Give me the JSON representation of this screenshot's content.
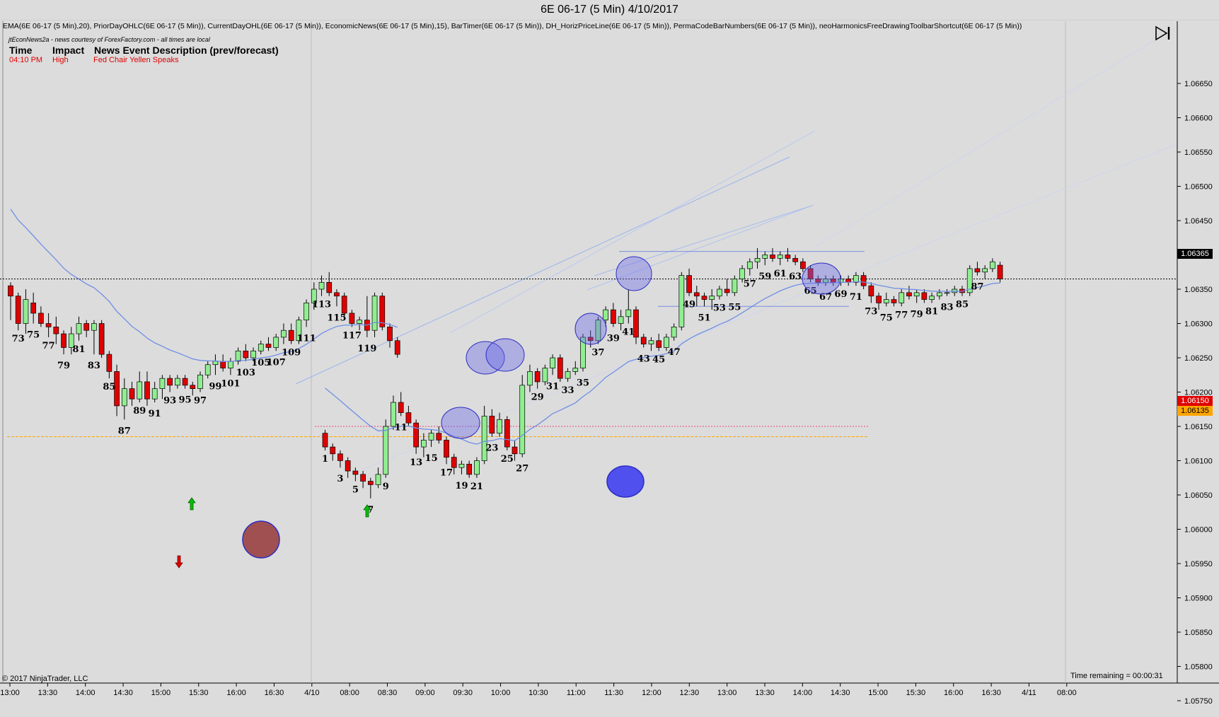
{
  "window": {
    "title": "6E 06-17 (5 Min)  4/10/2017"
  },
  "indicators_line": "EMA(6E 06-17 (5 Min),20), PriorDayOHLC(6E 06-17 (5 Min)), CurrentDayOHL(6E 06-17 (5 Min)), EconomicNews(6E 06-17 (5 Min),15), BarTimer(6E 06-17 (5 Min)), DH_HorizPriceLine(6E 06-17 (5 Min)), PermaCodeBarNumbers(6E 06-17 (5 Min)), neoHarmonicsFreeDrawingToolbarShortcut(6E 06-17 (5 Min))",
  "news": {
    "credit": "jtEconNews2a - news courtesy of ForexFactory.com - all times are local",
    "headers": {
      "time": "Time",
      "impact": "Impact",
      "desc": "News Event Description (prev/forecast)"
    },
    "event": {
      "time": "04:10 PM",
      "impact": "High",
      "desc": "Fed Chair Yellen Speaks"
    }
  },
  "footer": {
    "copyright": "© 2017 NinjaTrader, LLC",
    "time_remaining": "Time remaining = 00:00:31"
  },
  "colors": {
    "up": "#90ee90",
    "down": "#e00000",
    "ema": "#6f8fe6",
    "circle": "#6a6ae8",
    "orange": "#ffa500",
    "pink": "#e84a7a",
    "background": "#dcdcdc"
  },
  "icons": {
    "play": "skip-forward-icon",
    "up_arrow": "green-up-arrow-icon",
    "down_arrow": "red-down-arrow-icon"
  },
  "chart_data": {
    "type": "candlestick",
    "title": "6E 06-17 (5 Min)  4/10/2017",
    "ylim": [
      1.0573,
      1.067
    ],
    "yticks": [
      "1.06650",
      "1.06600",
      "1.06550",
      "1.06500",
      "1.06450",
      "1.06400",
      "1.06350",
      "1.06300",
      "1.06250",
      "1.06200",
      "1.06150",
      "1.06100",
      "1.06050",
      "1.06000",
      "1.05950",
      "1.05900",
      "1.05850",
      "1.05800",
      "1.05750"
    ],
    "xticks": [
      "13:00",
      "13:30",
      "14:00",
      "14:30",
      "15:00",
      "15:30",
      "16:00",
      "16:30",
      "4/10",
      "08:00",
      "08:30",
      "09:00",
      "09:30",
      "10:00",
      "10:30",
      "11:00",
      "11:30",
      "12:00",
      "12:30",
      "13:00",
      "13:30",
      "14:00",
      "14:30",
      "15:00",
      "15:30",
      "16:00",
      "16:30",
      "4/11",
      "08:00"
    ],
    "grid": false,
    "sessions": [
      {
        "start_bar": 72,
        "candles": [
          [
            1.06355,
            1.0636,
            1.06305,
            1.0634
          ],
          [
            1.0634,
            1.06345,
            1.0629,
            1.063
          ],
          [
            1.063,
            1.0635,
            1.06285,
            1.06335
          ],
          [
            1.0633,
            1.06345,
            1.063,
            1.06315
          ],
          [
            1.06315,
            1.06325,
            1.06295,
            1.063
          ],
          [
            1.063,
            1.06315,
            1.0628,
            1.06295
          ],
          [
            1.06295,
            1.0631,
            1.0627,
            1.06285
          ],
          [
            1.06285,
            1.0629,
            1.06255,
            1.06265
          ],
          [
            1.06265,
            1.06295,
            1.06255,
            1.06285
          ],
          [
            1.06285,
            1.0631,
            1.06275,
            1.063
          ],
          [
            1.063,
            1.06305,
            1.0628,
            1.0629
          ],
          [
            1.0629,
            1.06305,
            1.06255,
            1.063
          ],
          [
            1.063,
            1.06305,
            1.0625,
            1.06255
          ],
          [
            1.06255,
            1.0626,
            1.0622,
            1.0623
          ],
          [
            1.0623,
            1.0624,
            1.06165,
            1.0618
          ],
          [
            1.0618,
            1.0622,
            1.0616,
            1.06205
          ],
          [
            1.06205,
            1.06215,
            1.0618,
            1.0619
          ],
          [
            1.0619,
            1.0623,
            1.06185,
            1.06215
          ],
          [
            1.06215,
            1.0623,
            1.0618,
            1.0619
          ],
          [
            1.0619,
            1.06215,
            1.06185,
            1.06205
          ],
          [
            1.06205,
            1.06225,
            1.0619,
            1.0622
          ],
          [
            1.0622,
            1.06225,
            1.062,
            1.0621
          ],
          [
            1.0621,
            1.06225,
            1.06205,
            1.0622
          ],
          [
            1.0622,
            1.06225,
            1.06205,
            1.0621
          ],
          [
            1.0621,
            1.06215,
            1.06195,
            1.06205
          ],
          [
            1.06205,
            1.0623,
            1.062,
            1.06225
          ],
          [
            1.06225,
            1.06245,
            1.0622,
            1.0624
          ],
          [
            1.0624,
            1.06255,
            1.06225,
            1.06245
          ],
          [
            1.06245,
            1.06255,
            1.0623,
            1.06235
          ],
          [
            1.06235,
            1.0625,
            1.06225,
            1.06245
          ],
          [
            1.06245,
            1.06265,
            1.0624,
            1.0626
          ],
          [
            1.0626,
            1.0627,
            1.06245,
            1.0625
          ],
          [
            1.0625,
            1.06265,
            1.06245,
            1.0626
          ],
          [
            1.0626,
            1.06275,
            1.06255,
            1.0627
          ],
          [
            1.0627,
            1.0628,
            1.0626,
            1.06265
          ],
          [
            1.06265,
            1.06285,
            1.0626,
            1.0628
          ],
          [
            1.0628,
            1.063,
            1.0627,
            1.0629
          ],
          [
            1.0629,
            1.063,
            1.0627,
            1.06275
          ],
          [
            1.06275,
            1.0631,
            1.0627,
            1.06305
          ],
          [
            1.06305,
            1.06335,
            1.06295,
            1.0633
          ],
          [
            1.0633,
            1.0636,
            1.0632,
            1.0635
          ],
          [
            1.0635,
            1.0637,
            1.0634,
            1.0636
          ],
          [
            1.0636,
            1.06375,
            1.0634,
            1.06345
          ],
          [
            1.06345,
            1.0635,
            1.06325,
            1.0634
          ],
          [
            1.0634,
            1.06345,
            1.0631,
            1.06315
          ],
          [
            1.06315,
            1.0632,
            1.06295,
            1.063
          ],
          [
            1.063,
            1.0631,
            1.0629,
            1.06305
          ],
          [
            1.06305,
            1.0634,
            1.0628,
            1.0629
          ],
          [
            1.0629,
            1.06345,
            1.0628,
            1.0634
          ],
          [
            1.0634,
            1.06345,
            1.0629,
            1.06295
          ],
          [
            1.06295,
            1.063,
            1.06265,
            1.06275
          ],
          [
            1.06275,
            1.0628,
            1.0625,
            1.06255
          ]
        ]
      },
      {
        "start_bar": 1,
        "candles": [
          [
            1.0614,
            1.06145,
            1.06115,
            1.0612
          ],
          [
            1.0612,
            1.06125,
            1.061,
            1.0611
          ],
          [
            1.0611,
            1.06115,
            1.0609,
            1.061
          ],
          [
            1.061,
            1.06105,
            1.06075,
            1.06085
          ],
          [
            1.06085,
            1.0609,
            1.0607,
            1.0608
          ],
          [
            1.0608,
            1.06085,
            1.0606,
            1.0607
          ],
          [
            1.0607,
            1.06075,
            1.06045,
            1.06065
          ],
          [
            1.06065,
            1.0609,
            1.0606,
            1.0608
          ],
          [
            1.0608,
            1.0616,
            1.06075,
            1.0615
          ],
          [
            1.0615,
            1.06195,
            1.06145,
            1.06185
          ],
          [
            1.06185,
            1.062,
            1.06165,
            1.0617
          ],
          [
            1.0617,
            1.0618,
            1.0615,
            1.06155
          ],
          [
            1.06155,
            1.0616,
            1.0611,
            1.0612
          ],
          [
            1.0612,
            1.0614,
            1.06105,
            1.0613
          ],
          [
            1.0613,
            1.06145,
            1.0612,
            1.0614
          ],
          [
            1.0614,
            1.0615,
            1.06125,
            1.0613
          ],
          [
            1.0613,
            1.06135,
            1.06095,
            1.06105
          ],
          [
            1.06105,
            1.0611,
            1.0608,
            1.0609
          ],
          [
            1.0609,
            1.061,
            1.0608,
            1.06095
          ],
          [
            1.06095,
            1.061,
            1.06075,
            1.0608
          ],
          [
            1.0608,
            1.06105,
            1.06075,
            1.061
          ],
          [
            1.061,
            1.0618,
            1.06095,
            1.06165
          ],
          [
            1.06165,
            1.06175,
            1.06135,
            1.0614
          ],
          [
            1.0614,
            1.0617,
            1.06135,
            1.0616
          ],
          [
            1.0616,
            1.06165,
            1.06115,
            1.0612
          ],
          [
            1.0612,
            1.0613,
            1.061,
            1.0611
          ],
          [
            1.0611,
            1.06225,
            1.06105,
            1.0621
          ],
          [
            1.0621,
            1.0624,
            1.062,
            1.0623
          ],
          [
            1.0623,
            1.06235,
            1.06205,
            1.06215
          ],
          [
            1.06215,
            1.0624,
            1.0621,
            1.06235
          ],
          [
            1.06235,
            1.06255,
            1.06225,
            1.0625
          ],
          [
            1.0625,
            1.06255,
            1.06215,
            1.0622
          ],
          [
            1.0622,
            1.06235,
            1.06215,
            1.0623
          ],
          [
            1.0623,
            1.06245,
            1.06225,
            1.06235
          ],
          [
            1.06235,
            1.06285,
            1.0623,
            1.0628
          ],
          [
            1.0628,
            1.0629,
            1.06265,
            1.06275
          ],
          [
            1.06275,
            1.0631,
            1.0627,
            1.06305
          ],
          [
            1.06305,
            1.06325,
            1.06295,
            1.0632
          ],
          [
            1.0632,
            1.0633,
            1.06295,
            1.063
          ],
          [
            1.063,
            1.0632,
            1.0629,
            1.0631
          ],
          [
            1.0631,
            1.0635,
            1.063,
            1.0632
          ],
          [
            1.0632,
            1.06325,
            1.0627,
            1.0628
          ],
          [
            1.0628,
            1.06285,
            1.06265,
            1.0627
          ],
          [
            1.0627,
            1.0628,
            1.0626,
            1.06275
          ],
          [
            1.06275,
            1.06285,
            1.0626,
            1.06265
          ],
          [
            1.06265,
            1.06285,
            1.0626,
            1.0628
          ],
          [
            1.0628,
            1.063,
            1.06275,
            1.06295
          ],
          [
            1.06295,
            1.06375,
            1.0629,
            1.0637
          ],
          [
            1.0637,
            1.0638,
            1.0634,
            1.06345
          ],
          [
            1.06345,
            1.06355,
            1.06325,
            1.0634
          ],
          [
            1.0634,
            1.06345,
            1.06325,
            1.06335
          ],
          [
            1.06335,
            1.0635,
            1.0632,
            1.0634
          ],
          [
            1.0634,
            1.06355,
            1.06335,
            1.0635
          ],
          [
            1.0635,
            1.06365,
            1.0634,
            1.06345
          ],
          [
            1.06345,
            1.0637,
            1.0634,
            1.06365
          ],
          [
            1.06365,
            1.06385,
            1.0636,
            1.0638
          ],
          [
            1.0638,
            1.06395,
            1.0637,
            1.0639
          ],
          [
            1.0639,
            1.0641,
            1.0638,
            1.06395
          ],
          [
            1.06395,
            1.06405,
            1.06385,
            1.064
          ],
          [
            1.064,
            1.0641,
            1.0639,
            1.06395
          ],
          [
            1.06395,
            1.06405,
            1.06385,
            1.064
          ],
          [
            1.064,
            1.0641,
            1.0639,
            1.06395
          ],
          [
            1.06395,
            1.064,
            1.06385,
            1.0639
          ],
          [
            1.0639,
            1.06395,
            1.06375,
            1.0638
          ],
          [
            1.0638,
            1.06385,
            1.0636,
            1.06365
          ],
          [
            1.06365,
            1.0637,
            1.06355,
            1.0636
          ],
          [
            1.0636,
            1.0637,
            1.06355,
            1.06365
          ],
          [
            1.06365,
            1.0637,
            1.06355,
            1.0636
          ],
          [
            1.0636,
            1.0637,
            1.06355,
            1.06365
          ],
          [
            1.06365,
            1.0637,
            1.06355,
            1.0636
          ],
          [
            1.0636,
            1.06375,
            1.06355,
            1.0637
          ],
          [
            1.0637,
            1.06375,
            1.0635,
            1.06355
          ],
          [
            1.06355,
            1.0636,
            1.0633,
            1.0634
          ],
          [
            1.0634,
            1.06345,
            1.0632,
            1.0633
          ],
          [
            1.0633,
            1.06345,
            1.06325,
            1.06335
          ],
          [
            1.06335,
            1.0634,
            1.06325,
            1.0633
          ],
          [
            1.0633,
            1.0635,
            1.06325,
            1.06345
          ],
          [
            1.06345,
            1.06355,
            1.06335,
            1.0634
          ],
          [
            1.0634,
            1.0635,
            1.0633,
            1.06345
          ],
          [
            1.06345,
            1.0635,
            1.0633,
            1.06335
          ],
          [
            1.06335,
            1.06345,
            1.0633,
            1.0634
          ],
          [
            1.0634,
            1.0635,
            1.06335,
            1.06345
          ],
          [
            1.06345,
            1.0635,
            1.0634,
            1.06345
          ],
          [
            1.06345,
            1.06355,
            1.0634,
            1.0635
          ],
          [
            1.0635,
            1.06355,
            1.0634,
            1.06345
          ],
          [
            1.06345,
            1.06385,
            1.0634,
            1.0638
          ],
          [
            1.0638,
            1.0639,
            1.0637,
            1.06375
          ],
          [
            1.06375,
            1.06385,
            1.06365,
            1.0638
          ],
          [
            1.0638,
            1.06395,
            1.06375,
            1.0639
          ],
          [
            1.06385,
            1.0639,
            1.0636,
            1.06365
          ]
        ]
      }
    ],
    "bar_number_labels": {
      "session1": [
        "73",
        "75",
        "77",
        "79",
        "81",
        "83",
        "85",
        "87",
        "89",
        "91",
        "93",
        "95",
        "97",
        "99",
        "101",
        "103",
        "105",
        "107",
        "109",
        "111",
        "113",
        "115",
        "117",
        "119"
      ],
      "session2": [
        "1",
        "3",
        "5",
        "7",
        "9",
        "11",
        "13",
        "15",
        "17",
        "19",
        "21",
        "23",
        "25",
        "27",
        "29",
        "31",
        "33",
        "35",
        "37",
        "39",
        "41",
        "43",
        "45",
        "47",
        "49",
        "51",
        "53",
        "55",
        "57",
        "59",
        "61",
        "63",
        "65",
        "67",
        "69",
        "71",
        "73",
        "75",
        "77",
        "79",
        "81",
        "83",
        "85",
        "87"
      ]
    },
    "ema_period": 20,
    "price_labels": {
      "last": "1.06365",
      "mid": "1.06150",
      "low": "1.06135"
    },
    "levels": {
      "last": 1.06365,
      "pink": 1.0615,
      "orange": 1.06135,
      "range_high": 1.06405,
      "range_low": 1.06325
    },
    "markers": [
      {
        "type": "up_arrow",
        "bar": "between 106 and 107 (prior session)",
        "price": 1.05995
      },
      {
        "type": "down_arrow",
        "bar": "at 104 (prior session)",
        "price": 1.05912
      },
      {
        "type": "up_arrow",
        "bar": "8",
        "price": 1.05985
      },
      {
        "type": "circle_red",
        "bar": "around 113 (prior session)",
        "price": 1.05955
      },
      {
        "type": "circle_blue",
        "bar": "between 48 and 49",
        "price": 1.06035
      }
    ]
  }
}
